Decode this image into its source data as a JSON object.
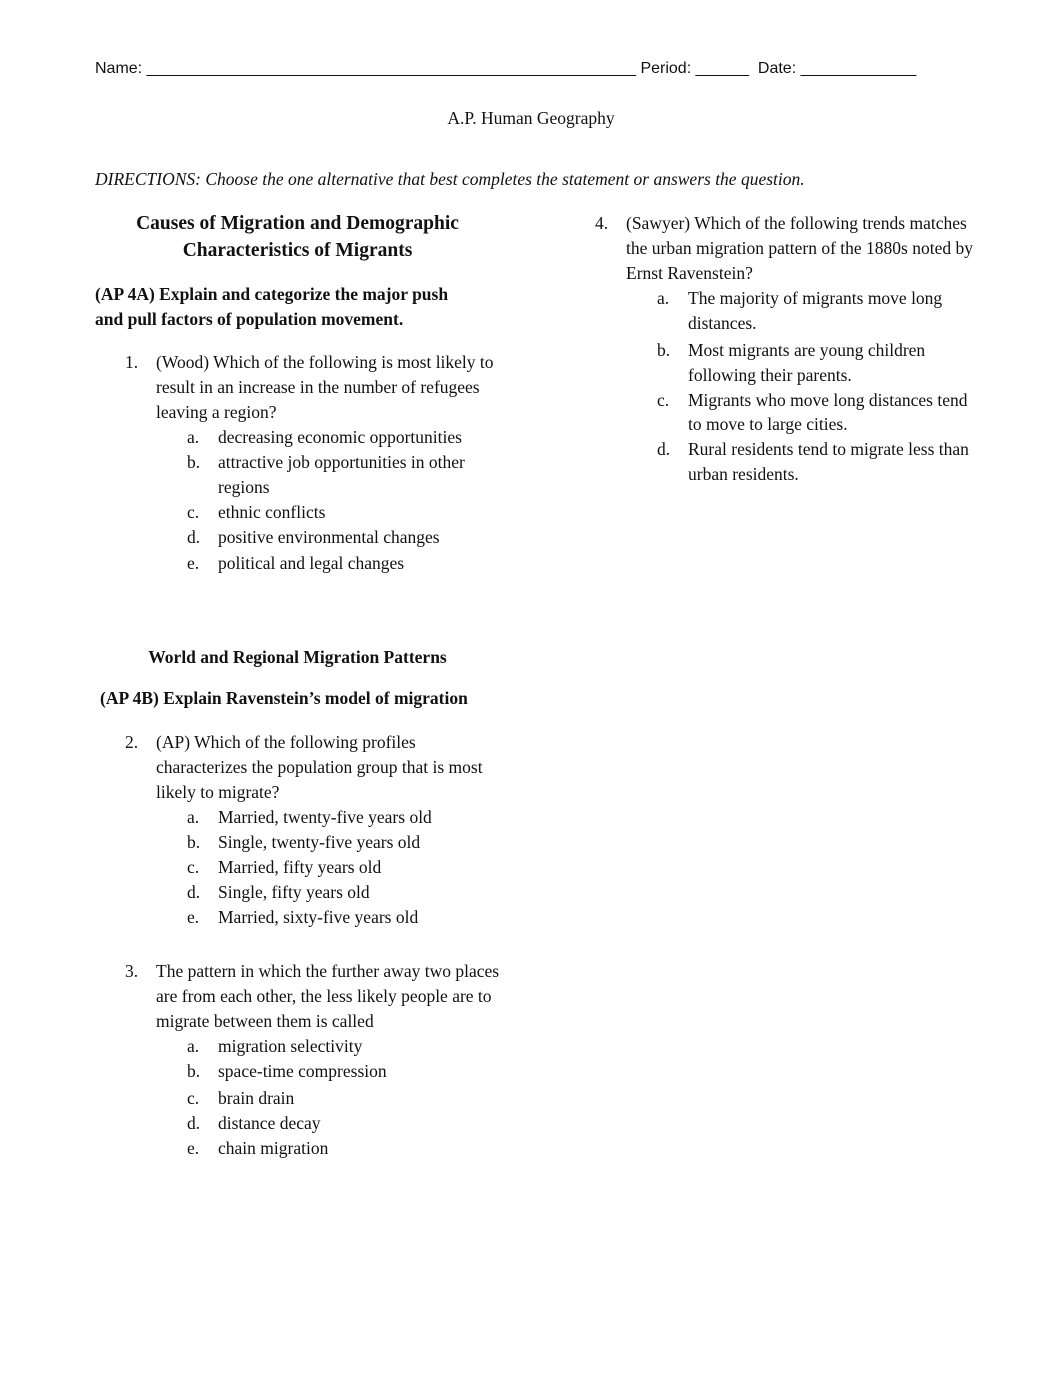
{
  "header": {
    "name_label": "Name:",
    "name_blank": "_______________________________________________________",
    "period_label": "Period:",
    "period_blank": "______",
    "date_label": "Date:",
    "date_blank": "_____________"
  },
  "course_title": "A.P. Human Geography",
  "directions": "DIRECTIONS: Choose the one alternative that best completes the statement or answers the question.",
  "sections": [
    {
      "title_line1": "Causes of Migration and Demographic",
      "title_line2": "Characteristics of Migrants",
      "objective_line1": "(AP 4A) Explain and categorize the major push",
      "objective_line2": "and pull factors of population movement."
    },
    {
      "title": "World and Regional Migration Patterns",
      "objective": "(AP 4B) Explain Ravenstein’s model of migration"
    }
  ],
  "questions": [
    {
      "number": "1.",
      "text": "(Wood) Which of the following is most likely to result in an increase in the number of refugees leaving a region?",
      "options": [
        {
          "letter": "a.",
          "text": "decreasing economic opportunities"
        },
        {
          "letter": "b.",
          "text": "attractive job opportunities in other regions"
        },
        {
          "letter": "c.",
          "text": "ethnic conflicts"
        },
        {
          "letter": "d.",
          "text": "positive environmental changes"
        },
        {
          "letter": "e.",
          "text": "political and legal changes"
        }
      ]
    },
    {
      "number": "2.",
      "text": "(AP) Which of the following profiles characterizes the population group that is most likely to migrate?",
      "options": [
        {
          "letter": "a.",
          "text": "Married, twenty-five years old"
        },
        {
          "letter": "b.",
          "text": "Single, twenty-five years old"
        },
        {
          "letter": "c.",
          "text": "Married, fifty years old"
        },
        {
          "letter": "d.",
          "text": "Single, fifty years old"
        },
        {
          "letter": "e.",
          "text": "Married, sixty-five years old"
        }
      ]
    },
    {
      "number": "3.",
      "text": "The pattern in which the further away two places are from each other, the less likely people are to migrate between them is called",
      "options": [
        {
          "letter": "a.",
          "text": "migration selectivity"
        },
        {
          "letter": "b.",
          "text": "space-time compression"
        },
        {
          "letter": "c.",
          "text": "brain drain"
        },
        {
          "letter": "d.",
          "text": "distance decay"
        },
        {
          "letter": "e.",
          "text": "chain migration"
        }
      ]
    },
    {
      "number": "4.",
      "text": "(Sawyer) Which of the following trends matches the urban migration pattern of the 1880s noted by Ernst Ravenstein?",
      "options": [
        {
          "letter": "a.",
          "text": "The majority of migrants move long distances."
        },
        {
          "letter": "b.",
          "text": "Most migrants are young children following their parents."
        },
        {
          "letter": "c.",
          "text": "Migrants who move long distances tend to move to large cities."
        },
        {
          "letter": "d.",
          "text": "Rural residents tend to migrate less than urban residents."
        }
      ]
    }
  ]
}
